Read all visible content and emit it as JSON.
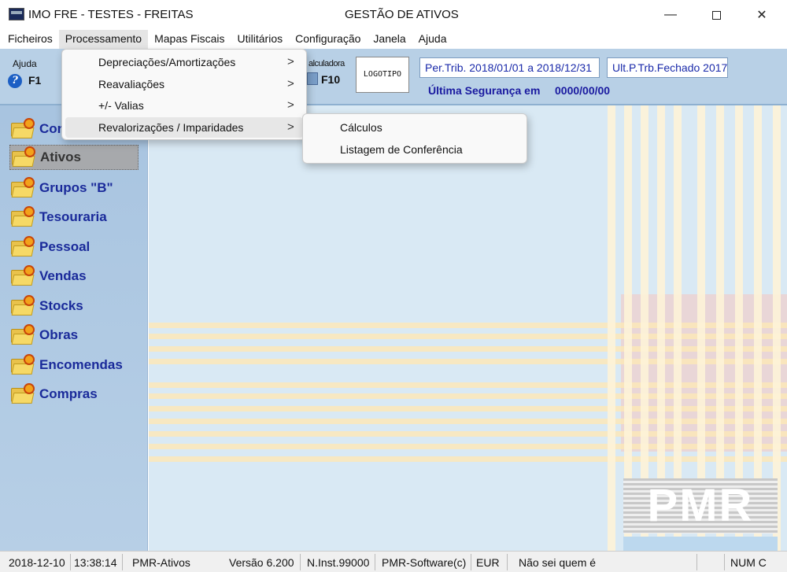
{
  "window": {
    "title_left": "IMO FRE - TESTES - FREITAS",
    "title_center": "GESTÃO DE ATIVOS",
    "minimize": "—",
    "close": "✕"
  },
  "menubar": {
    "items": [
      "Ficheiros",
      "Processamento",
      "Mapas Fiscais",
      "Utilitários",
      "Configuração",
      "Janela",
      "Ajuda"
    ]
  },
  "toolbar": {
    "help_label": "Ajuda",
    "help_key": "F1",
    "calc_label": "alculadora",
    "calc_key": "F10",
    "logo": "LOGOTIPO",
    "period": "Per.Trib. 2018/01/01 a 2018/12/31",
    "closed": "Ult.P.Trb.Fechado 2017",
    "backup_label": "Última Segurança em",
    "backup_value": "0000/00/00"
  },
  "sidebar": {
    "items": [
      "Con",
      "Ativos",
      "Grupos \"B\"",
      "Tesouraria",
      "Pessoal",
      "Vendas",
      "Stocks",
      "Obras",
      "Encomendas",
      "Compras"
    ],
    "selected": "Ativos"
  },
  "dropdown": {
    "items": [
      "Depreciações/Amortizações",
      "Reavaliações",
      "+/- Valias",
      "Revalorizações / Imparidades"
    ],
    "arrow": ">",
    "hovered": "Revalorizações / Imparidades"
  },
  "submenu": {
    "items": [
      "Cálculos",
      "Listagem de Conferência"
    ]
  },
  "background": {
    "brand": "PMR"
  },
  "statusbar": {
    "date": "2018-12-10",
    "time": "13:38:14",
    "module": "PMR-Ativos",
    "version": "Versão  6.200",
    "installation": "N.Inst.99000",
    "company": "PMR-Software(c)",
    "currency": "EUR",
    "user": "Não sei quem é",
    "numlock": "NUM C"
  },
  "colors": {
    "sidebar_bg": "#a8c4e0",
    "sidebar_text": "#1a2a9a",
    "toolbar_bg": "#b8d0e6",
    "accent_blue_text": "#1a2aaa"
  }
}
